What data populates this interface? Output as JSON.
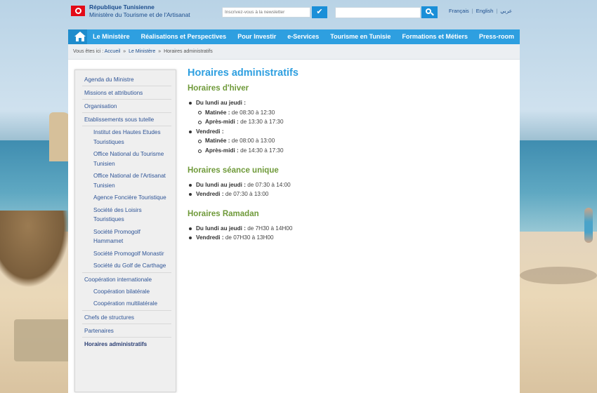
{
  "header": {
    "org_line1": "République Tunisienne",
    "org_line2": "Ministère du Tourisme et de l'Artisanat",
    "newsletter_placeholder": "Inscrivez-vous à la newsletter",
    "newsletter_icon": "check-icon",
    "search_placeholder": "",
    "search_icon": "search-icon",
    "languages": [
      "Français",
      "English",
      "عربي"
    ]
  },
  "nav": {
    "home_icon": "home-icon",
    "items": [
      "Le Ministère",
      "Réalisations et Perspectives",
      "Pour Investir",
      "e-Services",
      "Tourisme en Tunisie",
      "Formations et Métiers",
      "Press-room"
    ]
  },
  "breadcrumb": {
    "prefix": "Vous êtes ici :",
    "links": [
      "Accueil",
      "Le Ministère"
    ],
    "current": "Horaires administratifs",
    "separator": "»"
  },
  "sidebar": {
    "items": [
      "Agenda du Ministre",
      "Missions et attributions",
      "Organisation",
      "Etablissements sous tutelle",
      "Institut des Hautes Etudes Touristiques",
      "Office National du Tourisme Tunisien",
      "Office National de l'Artisanat Tunisien",
      "Agence Foncière Touristique",
      "Société des Loisirs Touristiques",
      "Société Promogolf Hammamet",
      "Société Promogolf Monastir",
      "Société du Golf de Carthage",
      "Coopération internationale",
      "Coopération bilatérale",
      "Coopération multilatérale",
      "Chefs de structures",
      "Partenaires",
      "Horaires administratifs"
    ]
  },
  "article": {
    "title": "Horaires administratifs",
    "sections": [
      {
        "title": "Horaires d'hiver",
        "days": [
          {
            "label": "Du lundi au jeudi :",
            "slots": [
              {
                "label": "Matinée :",
                "value": "de 08:30 à 12:30"
              },
              {
                "label": "Après-midi :",
                "value": "de 13:30 à 17:30"
              }
            ]
          },
          {
            "label": "Vendredi :",
            "slots": [
              {
                "label": "Matinée :",
                "value": "de 08:00 à 13:00"
              },
              {
                "label": "Après-midi :",
                "value": "de 14:30 à 17:30"
              }
            ]
          }
        ]
      },
      {
        "title": "Horaires séance unique",
        "lines": [
          {
            "label": "Du lundi au jeudi :",
            "value": "de 07:30 à 14:00"
          },
          {
            "label": "Vendredi :",
            "value": "de 07:30 à 13:00"
          }
        ]
      },
      {
        "title": "Horaires Ramadan",
        "lines": [
          {
            "label": "Du lundi au jeudi :",
            "value": "de 7H30 à 14H00"
          },
          {
            "label": "Vendredi :",
            "value": "de 07H30 à 13H00"
          }
        ]
      }
    ]
  },
  "colors": {
    "nav_bg": "#2e9fe0",
    "title_blue": "#2e9fe0",
    "section_green": "#6f9a3a",
    "link_blue": "#2f5597"
  }
}
